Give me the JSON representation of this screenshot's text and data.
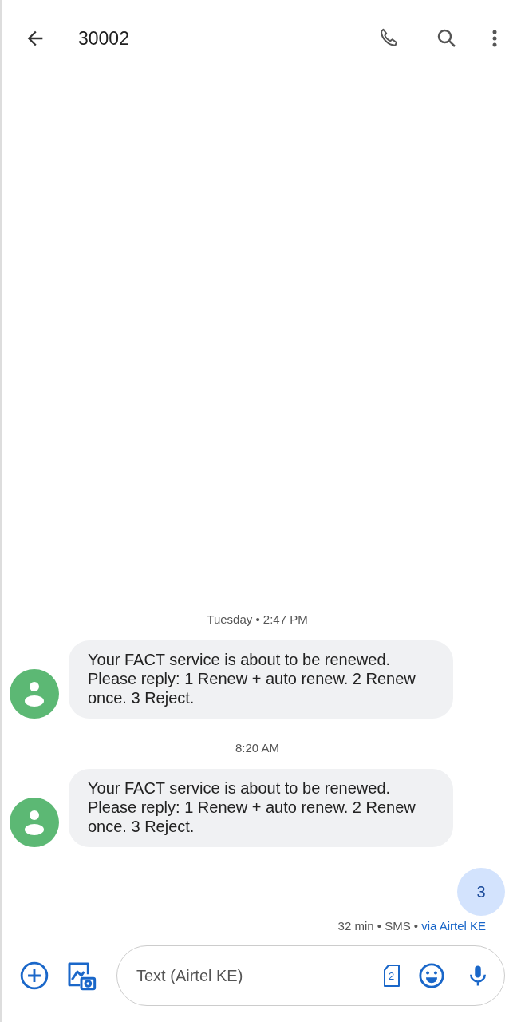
{
  "header": {
    "title": "30002"
  },
  "messages": [
    {
      "kind": "timestamp",
      "text": "Tuesday • 2:47 PM"
    },
    {
      "kind": "received",
      "text": "Your FACT service is about to be renewed. Please reply: 1 Renew + auto renew. 2 Renew once. 3 Reject."
    },
    {
      "kind": "timestamp",
      "text": "8:20 AM"
    },
    {
      "kind": "received",
      "text": "Your FACT service is about to be renewed. Please reply: 1 Renew + auto renew. 2 Renew once. 3 Reject."
    },
    {
      "kind": "sent",
      "text": "3"
    }
  ],
  "status": {
    "text": "32 min • SMS •",
    "carrier": "via Airtel KE"
  },
  "composer": {
    "placeholder": "Text (Airtel KE)",
    "sim_slot": "2"
  }
}
